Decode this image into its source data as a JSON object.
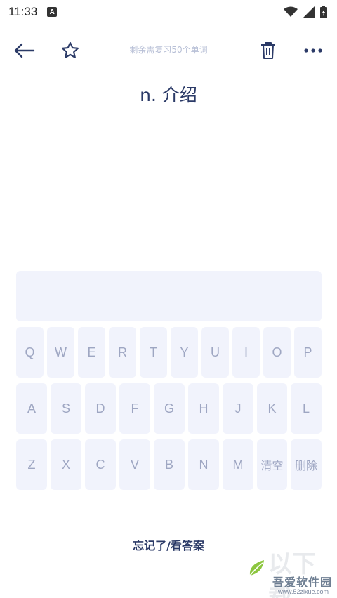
{
  "status_bar": {
    "time": "11:33",
    "notification_letter": "A"
  },
  "header": {
    "remaining_text": "剩余需复习50个单词"
  },
  "word": {
    "definition": "n. 介绍"
  },
  "keyboard": {
    "row1": [
      "Q",
      "W",
      "E",
      "R",
      "T",
      "Y",
      "U",
      "I",
      "O",
      "P"
    ],
    "row2": [
      "A",
      "S",
      "D",
      "F",
      "G",
      "H",
      "J",
      "K",
      "L"
    ],
    "row3": [
      "Z",
      "X",
      "C",
      "V",
      "B",
      "N",
      "M"
    ],
    "clear_label": "清空",
    "delete_label": "删除"
  },
  "footer": {
    "forgot_label": "忘记了/看答案"
  },
  "watermark": {
    "site_cn": "吾爱软件园",
    "site_url": "www.52zixue.com",
    "big_text": "以下载"
  },
  "icons": {
    "back": "arrow-left-icon",
    "favorite": "star-outline-icon",
    "delete": "trash-icon",
    "more": "more-dots-icon"
  },
  "colors": {
    "primary": "#2b3a67",
    "key_bg": "#f1f3fc",
    "key_text": "#9ea6c2",
    "muted": "#b7bfd6"
  }
}
